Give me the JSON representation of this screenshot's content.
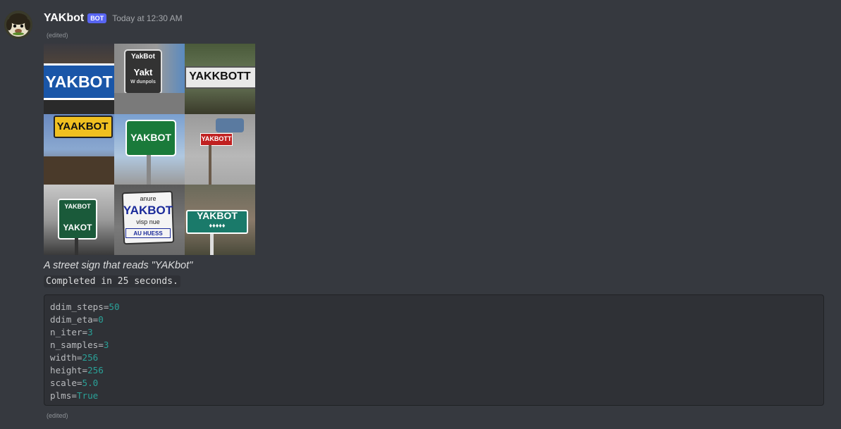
{
  "message": {
    "username": "YAKbot",
    "bot_tag": "BOT",
    "timestamp": "Today at 12:30 AM",
    "edited_top": "(edited)",
    "edited_bottom": "(edited)",
    "caption": "A street sign that reads \"YAKbot\"",
    "status": "Completed in 25 seconds.",
    "colors": {
      "background": "#36393f",
      "code_background": "#2f3136",
      "bot_tag": "#5865f2",
      "code_value": "#2aa198"
    }
  },
  "image_tiles": [
    {
      "text": "YAKBOT"
    },
    {
      "text": "YakBot",
      "text2": "Yakt",
      "text3": "W dunpols"
    },
    {
      "text": "YAKKBOTT"
    },
    {
      "text": "YAAKBOT"
    },
    {
      "text": "YAKBOT"
    },
    {
      "text": "YAKBOTT"
    },
    {
      "text": "YAKBOT",
      "text2": "YAKOT"
    },
    {
      "text": "anure",
      "text2": "YAKBOT",
      "text3": "visp nue",
      "text4": "AU HUESS"
    },
    {
      "text": "YAKBOT",
      "text2": "♦♦♦♦♦"
    }
  ],
  "params": [
    {
      "key": "ddim_steps",
      "value": "50"
    },
    {
      "key": "ddim_eta",
      "value": "0"
    },
    {
      "key": "n_iter",
      "value": "3"
    },
    {
      "key": "n_samples",
      "value": "3"
    },
    {
      "key": "width",
      "value": "256"
    },
    {
      "key": "height",
      "value": "256"
    },
    {
      "key": "scale",
      "value": "5.0"
    },
    {
      "key": "plms",
      "value": "True"
    }
  ]
}
